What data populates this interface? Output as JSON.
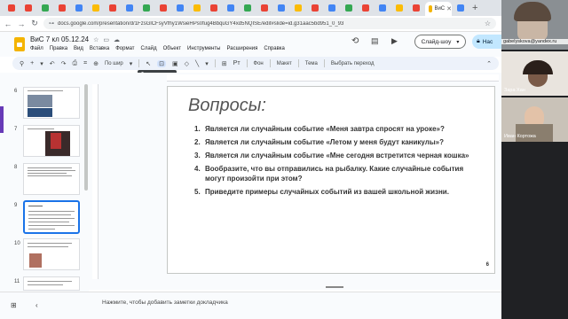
{
  "browser": {
    "active_tab_label": "ВиС",
    "url": "docs.google.com/presentation/d/1FzsGlCFsyVfhy1WsieHPs0fug4BbquGY4xd5NQISE/edit#slide=id.g31aac5bd951_0_93"
  },
  "app": {
    "doc_title": "ВиС 7 кл  05.12.24",
    "menu": [
      "Файл",
      "Правка",
      "Вид",
      "Вставка",
      "Формат",
      "Слайд",
      "Объект",
      "Инструменты",
      "Расширения",
      "Справка"
    ],
    "slideshow_label": "Слайд-шоу",
    "access_label": "Нас"
  },
  "toolbar": {
    "zoom_label": "По шир",
    "background_label": "Фон",
    "layout_label": "Макет",
    "theme_label": "Тема",
    "transition_label": "Выбрать переход",
    "tooltip": "Текстовое поле"
  },
  "filmstrip": {
    "numbers": [
      "6",
      "7",
      "8",
      "9",
      "10",
      "11"
    ],
    "selected_slide": 9
  },
  "slide": {
    "title": "Вопросы:",
    "questions": [
      {
        "n": "1.",
        "text": "Является ли случайным событие «Меня завтра спросят на уроке»?"
      },
      {
        "n": "2.",
        "text": "Является ли случайным событие «Летом у меня будут каникулы»?"
      },
      {
        "n": "3.",
        "text": "Является ли случайным событие «Мне сегодня встретится черная кошка»"
      },
      {
        "n": "4.",
        "text": "Вообразите, что вы отправились на рыбалку. Какие случайные события могут произойти при этом?"
      },
      {
        "n": "5.",
        "text": "Приведите примеры случайных событий из вашей школьной жизни."
      }
    ],
    "page_number": "6"
  },
  "notes": {
    "placeholder": "Нажмите, чтобы добавить заметки докладчика"
  },
  "video": {
    "self_email": "gabelyskova@yandex.ru",
    "participant_1": "Зара Хан",
    "participant_2": "Иван Кортожа"
  },
  "colors": {
    "accent": "#1a73e8",
    "toolbar_bg": "#edf2fa",
    "share_bg": "#c2e7ff"
  }
}
